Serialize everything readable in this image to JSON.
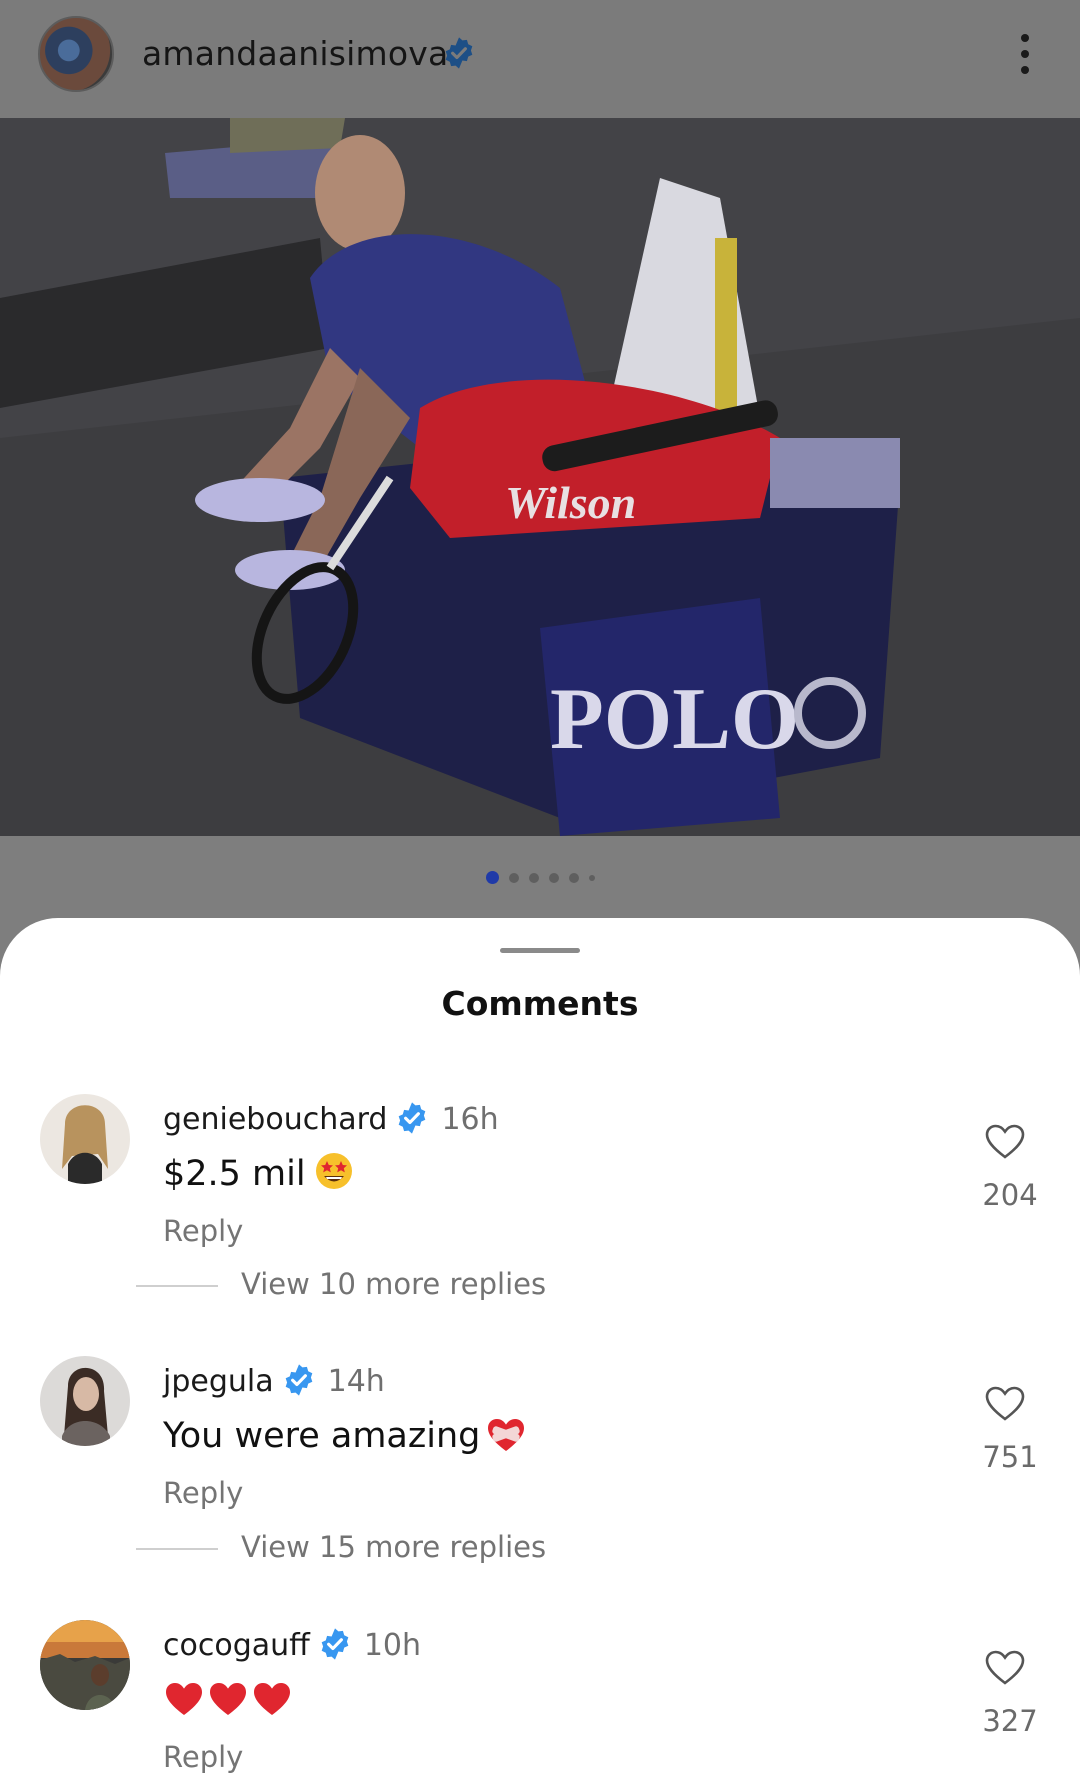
{
  "post": {
    "username": "amandaanisimova",
    "photo_texts": {
      "bag_brand": "Wilson",
      "cooler_brand": "POLO"
    },
    "carousel": {
      "count": 6,
      "active_index": 0
    }
  },
  "sheet": {
    "title": "Comments"
  },
  "comments": [
    {
      "username": "geniebouchard",
      "verified": true,
      "time": "16h",
      "text": "$2.5 mil",
      "emoji": "star-struck-emoji",
      "reply_label": "Reply",
      "likes": "204",
      "view_more": "View 10 more replies"
    },
    {
      "username": "jpegula",
      "verified": true,
      "time": "14h",
      "text": "You were amazing",
      "emoji": "mending-heart-emoji",
      "reply_label": "Reply",
      "likes": "751",
      "view_more": "View 15 more replies"
    },
    {
      "username": "cocogauff",
      "verified": true,
      "time": "10h",
      "text": "",
      "emoji": "red-heart-emoji x3",
      "reply_label": "Reply",
      "likes": "327"
    }
  ],
  "colors": {
    "verified_blue": "#3897f0",
    "overlay_gray": "#7e7e7e",
    "active_dot": "#1f3aa8",
    "heart_red": "#e0262f"
  }
}
